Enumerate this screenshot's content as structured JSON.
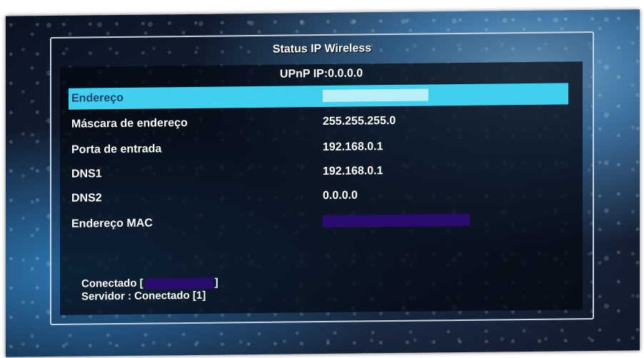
{
  "panel": {
    "title": "Status IP Wireless",
    "upnp": "UPnP IP:0.0.0.0"
  },
  "rows": [
    {
      "label": "Endereço",
      "value": "",
      "selected": true
    },
    {
      "label": "Máscara de endereço",
      "value": "255.255.255.0"
    },
    {
      "label": "Porta de entrada",
      "value": "192.168.0.1"
    },
    {
      "label": "DNS1",
      "value": "192.168.0.1"
    },
    {
      "label": "DNS2",
      "value": "0.0.0.0"
    },
    {
      "label": "Endereço MAC",
      "value": ""
    }
  ],
  "status": {
    "connected_prefix": "Conectado [",
    "connected_suffix": "]",
    "server": "Servidor : Conectado  [1]"
  },
  "colors": {
    "highlight": "#3fd0f0",
    "redaction": "#2a0c6e"
  }
}
